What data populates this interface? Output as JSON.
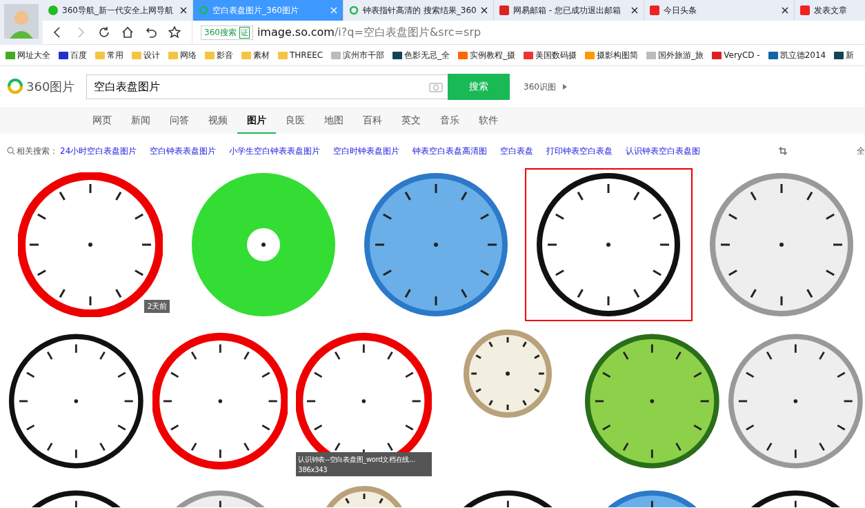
{
  "tabs": [
    {
      "label": "360导航_新一代安全上网导航",
      "selected": false
    },
    {
      "label": "空白表盘图片_360图片",
      "selected": true
    },
    {
      "label": "钟表指针高清的 搜索结果_360",
      "selected": false
    },
    {
      "label": "网易邮箱 - 您已成功退出邮箱",
      "selected": false
    },
    {
      "label": "今日头条",
      "selected": false
    },
    {
      "label": "发表文章",
      "selected": false
    }
  ],
  "address_bar": {
    "engine": "360搜索",
    "cert": "证",
    "host": "image.so.com",
    "path": "/i?q=空白表盘图片&src=srp"
  },
  "bookmarks": [
    "网址大全",
    "百度",
    "常用",
    "设计",
    "网络",
    "影音",
    "素材",
    "THREEC",
    "滨州市干部",
    "色影无忌_全",
    "实例教程_摄",
    "美国数码摄",
    "摄影构图简",
    "国外旅游_旅",
    "VeryCD -",
    "凯立德2014",
    "新"
  ],
  "logo": {
    "text": "360图片"
  },
  "search": {
    "value": "空白表盘图片",
    "button": "搜索",
    "extra": "360识图"
  },
  "nav": [
    {
      "label": "网页",
      "selected": false
    },
    {
      "label": "新闻",
      "selected": false
    },
    {
      "label": "问答",
      "selected": false
    },
    {
      "label": "视频",
      "selected": false
    },
    {
      "label": "图片",
      "selected": true
    },
    {
      "label": "良医",
      "selected": false
    },
    {
      "label": "地图",
      "selected": false
    },
    {
      "label": "百科",
      "selected": false
    },
    {
      "label": "英文",
      "selected": false
    },
    {
      "label": "音乐",
      "selected": false
    },
    {
      "label": "软件",
      "selected": false
    }
  ],
  "related": {
    "label": "相关搜索：",
    "links": [
      "24小时空白表盘图片",
      "空白钟表表盘图片",
      "小学生空白钟表表盘图片",
      "空白时钟表盘图片",
      "钟表空白表盘高清图",
      "空白表盘",
      "打印钟表空白表盘",
      "认识钟表空白表盘图"
    ],
    "tool": "全"
  },
  "results": [
    [
      {
        "kind": "red",
        "selected": false,
        "badge": "2天前"
      },
      {
        "kind": "green",
        "selected": false
      },
      {
        "kind": "blue",
        "selected": false
      },
      {
        "kind": "black",
        "selected": true
      },
      {
        "kind": "silver",
        "selected": false
      }
    ],
    [
      {
        "kind": "black",
        "selected": false
      },
      {
        "kind": "red",
        "selected": false
      },
      {
        "kind": "red",
        "selected": false,
        "caption": "认识钟表--空白表盘图_word文档在线...",
        "size": "386x343"
      },
      {
        "kind": "pocket",
        "selected": false
      },
      {
        "kind": "fern",
        "selected": false
      },
      {
        "kind": "silver",
        "selected": false
      }
    ],
    [
      {
        "kind": "black",
        "selected": false
      },
      {
        "kind": "silver",
        "selected": false
      },
      {
        "kind": "pocket",
        "selected": false
      },
      {
        "kind": "black",
        "selected": false
      },
      {
        "kind": "blue",
        "selected": false
      },
      {
        "kind": "black",
        "selected": false
      }
    ]
  ]
}
